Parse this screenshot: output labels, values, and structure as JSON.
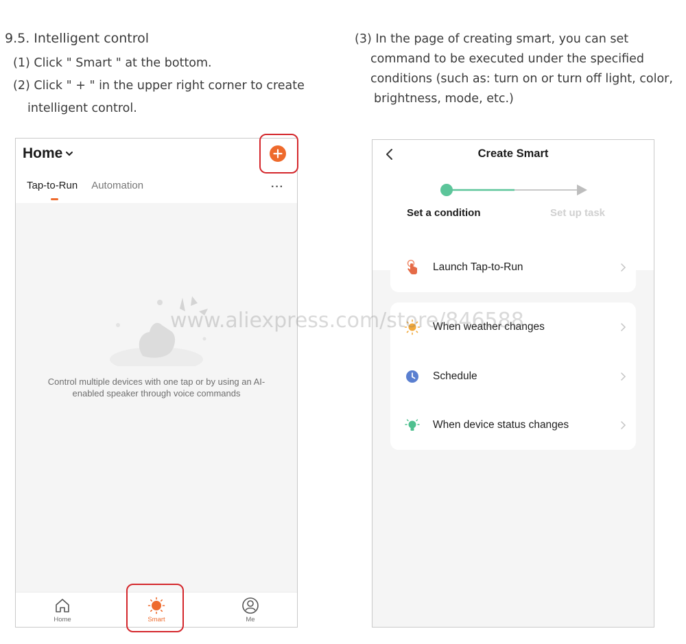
{
  "instructions_left": {
    "title": "9.5. Intelligent control",
    "step1": "(1) Click \" Smart \" at the bottom.",
    "step2_line1": "(2) Click \" + \" in the upper right corner to create",
    "step2_line2": "intelligent control."
  },
  "instructions_right": {
    "line1": "(3) In the page of creating smart, you can set",
    "line2": "command to be executed under the specified",
    "line3": "conditions (such as: turn on or turn off light, color,",
    "line4": "brightness, mode, etc.)"
  },
  "left_phone": {
    "home_title": "Home",
    "tabs": {
      "tap_to_run": "Tap-to-Run",
      "automation": "Automation"
    },
    "more_label": "···",
    "empty_message_line1": "Control multiple devices with one tap or by using an AI-",
    "empty_message_line2": "enabled speaker through voice commands",
    "tabbar": {
      "home": "Home",
      "smart": "Smart",
      "me": "Me"
    }
  },
  "right_phone": {
    "title": "Create Smart",
    "steps": {
      "step1": "Set a condition",
      "step2": "Set up task"
    },
    "options": {
      "launch": "Launch Tap-to-Run",
      "weather": "When weather changes",
      "schedule": "Schedule",
      "device_status": "When device status changes"
    }
  },
  "watermark": "www.aliexpress.com/store/846588",
  "colors": {
    "accent_orange": "#ee6a2c",
    "highlight_red": "#d4262b",
    "progress_green": "#5cc59a",
    "weather_yellow": "#f2a93b",
    "schedule_blue": "#5a7fd0",
    "device_green": "#4ec08f"
  },
  "icons": [
    "add-icon",
    "chevron-down-icon",
    "home-icon",
    "sun-icon",
    "profile-icon",
    "back-icon",
    "hand-tap-icon",
    "weather-icon",
    "clock-icon",
    "bulb-icon",
    "chevron-right-icon"
  ]
}
